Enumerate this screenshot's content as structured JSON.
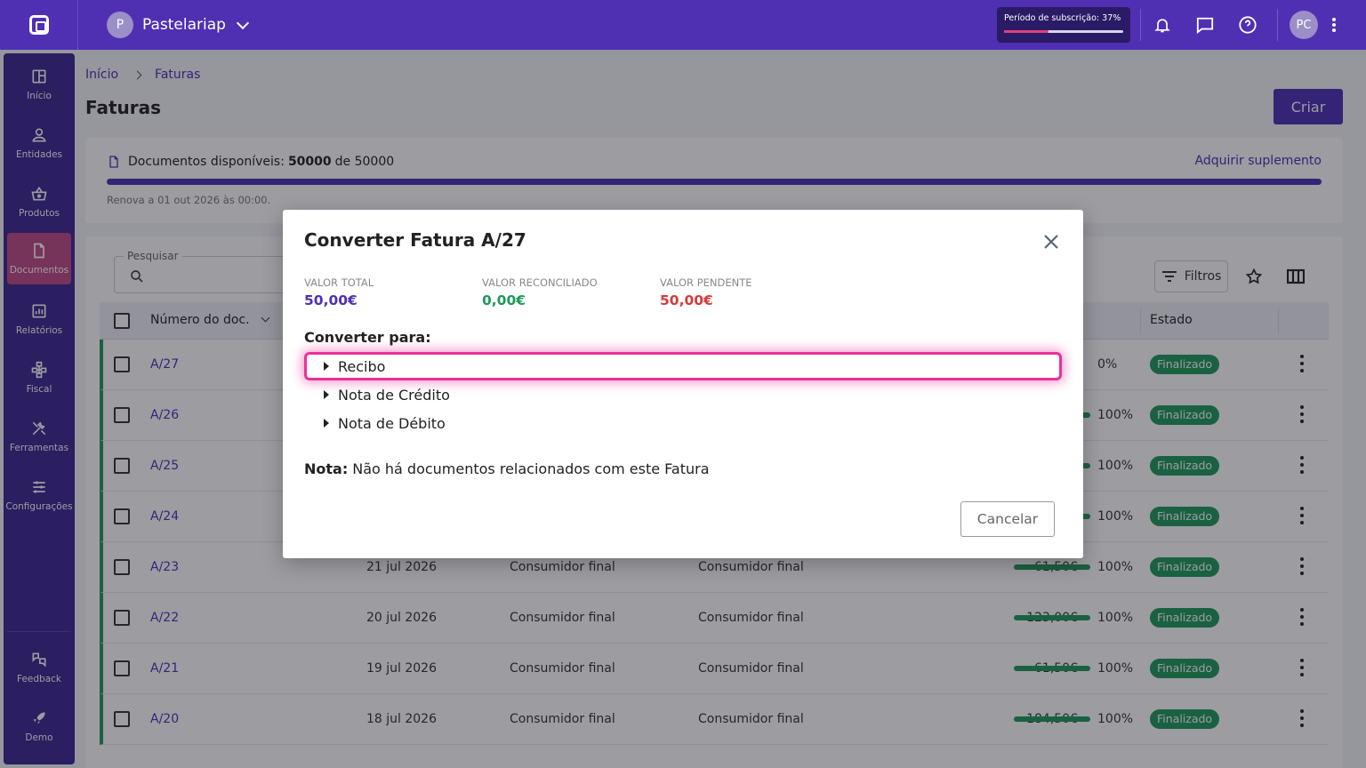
{
  "topbar": {
    "org_name": "Pastelariap",
    "org_initial": "P",
    "subscription_label": "Período de subscrição: 37%",
    "subscription_progress": 0.37,
    "user_initials": "PC"
  },
  "sidebar": {
    "items": [
      {
        "label": "Início",
        "icon": "home-icon"
      },
      {
        "label": "Entidades",
        "icon": "user-icon"
      },
      {
        "label": "Produtos",
        "icon": "basket-icon"
      },
      {
        "label": "Documentos",
        "icon": "document-icon"
      },
      {
        "label": "Relatórios",
        "icon": "chart-icon"
      },
      {
        "label": "Fiscal",
        "icon": "fiscal-icon"
      },
      {
        "label": "Ferramentas",
        "icon": "tools-icon"
      },
      {
        "label": "Configurações",
        "icon": "sliders-icon"
      }
    ],
    "bottom": [
      {
        "label": "Feedback",
        "icon": "feedback-icon"
      },
      {
        "label": "Demo",
        "icon": "rocket-icon"
      }
    ],
    "active": "Documentos"
  },
  "breadcrumb": {
    "home": "Início",
    "current": "Faturas"
  },
  "page": {
    "title": "Faturas",
    "create_label": "Criar"
  },
  "docs": {
    "prefix": "Documentos disponíveis:",
    "available": "50000",
    "of": "de 50000",
    "link": "Adquirir suplemento",
    "renew": "Renova a 01 out 2026 às 00:00."
  },
  "table": {
    "search_label": "Pesquisar",
    "filters_label": "Filtros",
    "headers": {
      "doc_number": "Número do doc.",
      "status": "Estado"
    },
    "rows": [
      {
        "doc": "A/27",
        "date": "",
        "entity": "",
        "name": "",
        "amount": "",
        "pct": "0%",
        "progress": 0,
        "status": "Finalizado"
      },
      {
        "doc": "A/26",
        "date": "",
        "entity": "",
        "name": "",
        "amount": "",
        "pct": "100%",
        "progress": 1,
        "status": "Finalizado"
      },
      {
        "doc": "A/25",
        "date": "",
        "entity": "",
        "name": "",
        "amount": "",
        "pct": "100%",
        "progress": 1,
        "status": "Finalizado"
      },
      {
        "doc": "A/24",
        "date": "",
        "entity": "",
        "name": "",
        "amount": "",
        "pct": "100%",
        "progress": 1,
        "status": "Finalizado"
      },
      {
        "doc": "A/23",
        "date": "21 jul 2026",
        "entity": "Consumidor final",
        "name": "Consumidor final",
        "amount": "61,50€",
        "pct": "100%",
        "progress": 1,
        "status": "Finalizado"
      },
      {
        "doc": "A/22",
        "date": "20 jul 2026",
        "entity": "Consumidor final",
        "name": "Consumidor final",
        "amount": "123,00€",
        "pct": "100%",
        "progress": 1,
        "status": "Finalizado"
      },
      {
        "doc": "A/21",
        "date": "19 jul 2026",
        "entity": "Consumidor final",
        "name": "Consumidor final",
        "amount": "61,50€",
        "pct": "100%",
        "progress": 1,
        "status": "Finalizado"
      },
      {
        "doc": "A/20",
        "date": "18 jul 2026",
        "entity": "Consumidor final",
        "name": "Consumidor final",
        "amount": "184,50€",
        "pct": "100%",
        "progress": 1,
        "status": "Finalizado"
      }
    ]
  },
  "modal": {
    "title": "Converter Fatura A/27",
    "values": [
      {
        "label": "VALOR TOTAL",
        "amount": "50,00€",
        "color": "#4f30b3"
      },
      {
        "label": "VALOR RECONCILIADO",
        "amount": "0,00€",
        "color": "#1f9a5a"
      },
      {
        "label": "VALOR PENDENTE",
        "amount": "50,00€",
        "color": "#d93a3a"
      }
    ],
    "convert_to": "Converter para:",
    "options": [
      "Recibo",
      "Nota de Crédito",
      "Nota de Débito"
    ],
    "note_label": "Nota:",
    "note_text": "Não há documentos relacionados com este Fatura",
    "cancel_label": "Cancelar"
  },
  "colors": {
    "primary": "#4f30b3",
    "success": "#1f9a5a",
    "danger": "#d93a3a",
    "highlight": "#ec2f9a"
  }
}
